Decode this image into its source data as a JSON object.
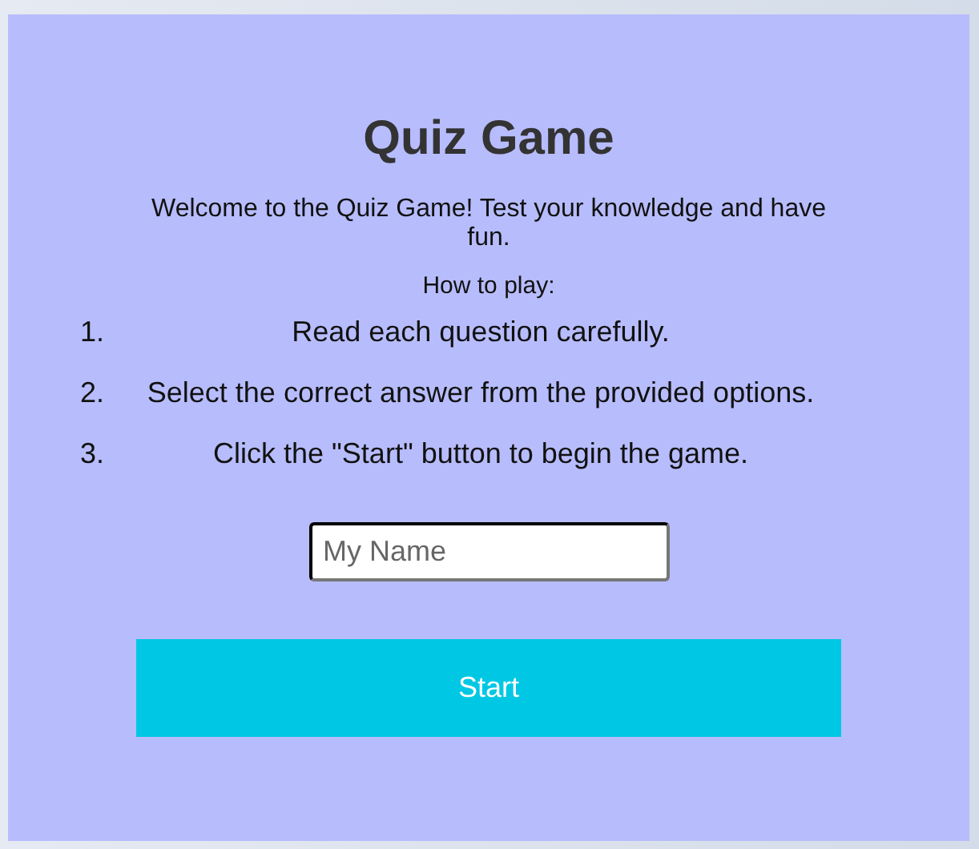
{
  "title": "Quiz Game",
  "intro": "Welcome to the Quiz Game! Test your knowledge and have fun.",
  "instructions_heading": "How to play:",
  "instructions": [
    {
      "number": "1.",
      "text": "Read each question carefully."
    },
    {
      "number": "2.",
      "text": "Select the correct answer from the provided options."
    },
    {
      "number": "3.",
      "text": "Click the \"Start\" button to begin the game."
    }
  ],
  "name_field": {
    "placeholder": "My Name"
  },
  "start_button": "Start"
}
